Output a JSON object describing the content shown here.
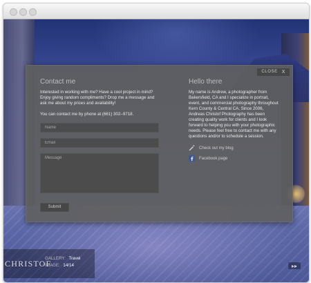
{
  "window": {
    "titlebar_controls": [
      "circle",
      "circle",
      "circle"
    ]
  },
  "modal": {
    "close_label": "CLOSE",
    "close_x": "X",
    "contact": {
      "heading": "Contact me",
      "intro": "Interested in working with me? Have a cool project in mind? Enjoy giving random compliments? Drop me a message and ask me about my prices and availability!",
      "phone_line": "You can contact me by phone at (661) 302–9718.",
      "fields": {
        "name_placeholder": "Name",
        "email_placeholder": "Email",
        "message_placeholder": "Message"
      },
      "submit_label": "Submit"
    },
    "about": {
      "heading": "Hello there",
      "body": "My name is Andrew, a photographer from Bakersfield, CA and I specialize in portrait, event, and commercial photography throughout Kern County & Central CA. Since 2006, Andreas Christof Photography has been creating quality work for clients and I look forward to helping you with your photographic needs. Please feel free to contact me with any questions and/or to schedule a session.",
      "links": [
        {
          "label": "Check out my blog",
          "icon": "edit-icon"
        },
        {
          "label": "Facebook page",
          "icon": "facebook-icon"
        }
      ]
    }
  },
  "bottom": {
    "brand": "CHRISTOF",
    "gallery_key": "GALLERY:",
    "gallery_value": "Travel",
    "image_key": "IMAGE:",
    "image_value": "14/14",
    "nav_icon": "next-icon"
  },
  "colors": {
    "modal_bg": "#5f5f5f",
    "modal_text": "#e9e9e9",
    "muted_text": "#bdbdbd"
  }
}
